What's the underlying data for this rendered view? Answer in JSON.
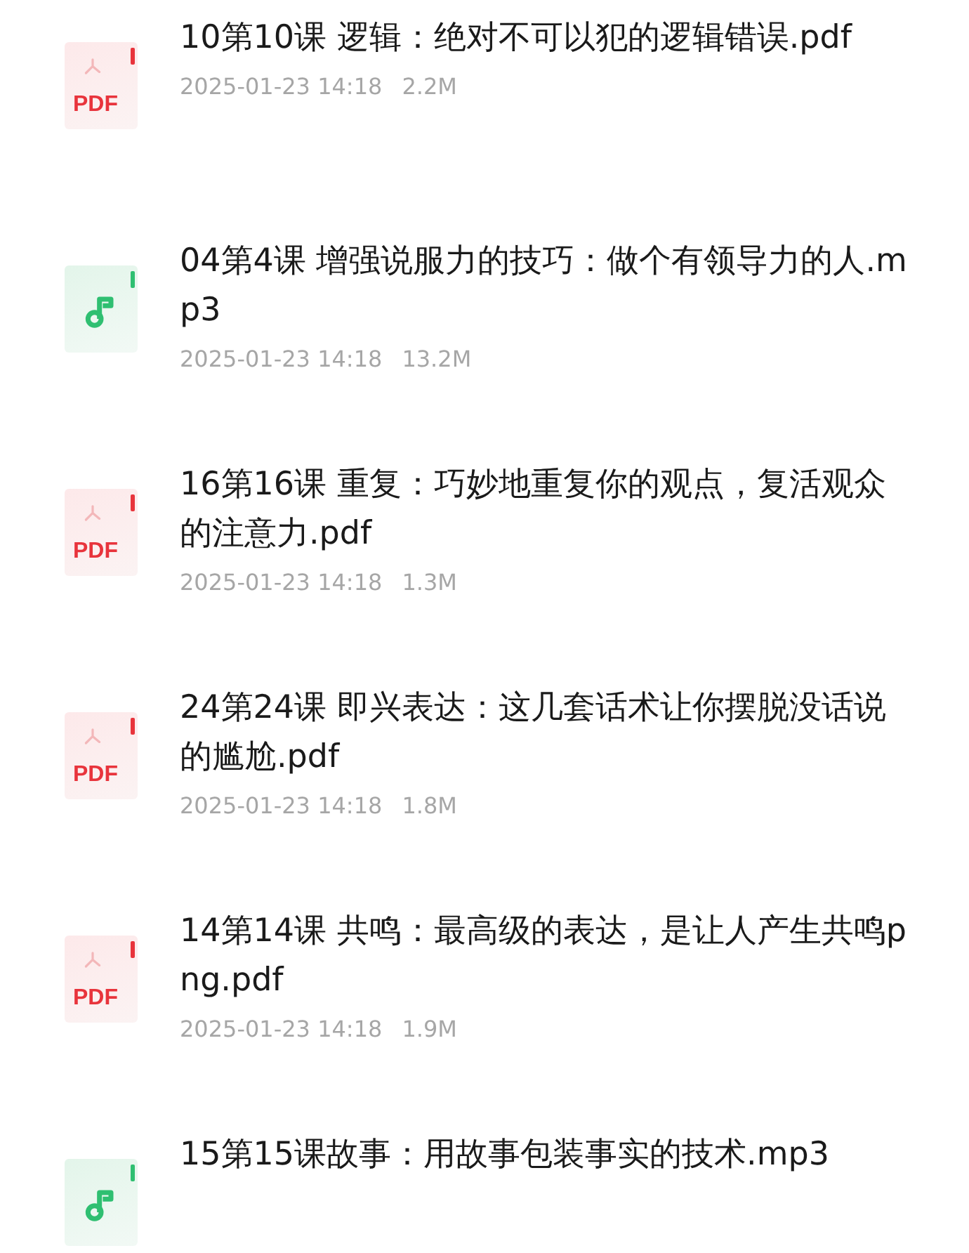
{
  "files": [
    {
      "kind": "pdf",
      "icon_label": "PDF",
      "name": "10第10课 逻辑：绝对不可以犯的逻辑错误.pdf",
      "date": "2025-01-23 14:18",
      "size": "2.2M"
    },
    {
      "kind": "audio",
      "name": "04第4课 增强说服力的技巧：做个有领导力的人.mp3",
      "date": "2025-01-23 14:18",
      "size": "13.2M"
    },
    {
      "kind": "pdf",
      "icon_label": "PDF",
      "name": "16第16课 重复：巧妙地重复你的观点，复活观众的注意力.pdf",
      "date": "2025-01-23 14:18",
      "size": "1.3M"
    },
    {
      "kind": "pdf",
      "icon_label": "PDF",
      "name": "24第24课 即兴表达：这几套话术让你摆脱没话说的尴尬.pdf",
      "date": "2025-01-23 14:18",
      "size": "1.8M"
    },
    {
      "kind": "pdf",
      "icon_label": "PDF",
      "name": "14第14课 共鸣：最高级的表达，是让人产生共鸣png.pdf",
      "date": "2025-01-23 14:18",
      "size": "1.9M"
    },
    {
      "kind": "audio",
      "name": "15第15课故事：用故事包装事实的技术.mp3"
    }
  ]
}
